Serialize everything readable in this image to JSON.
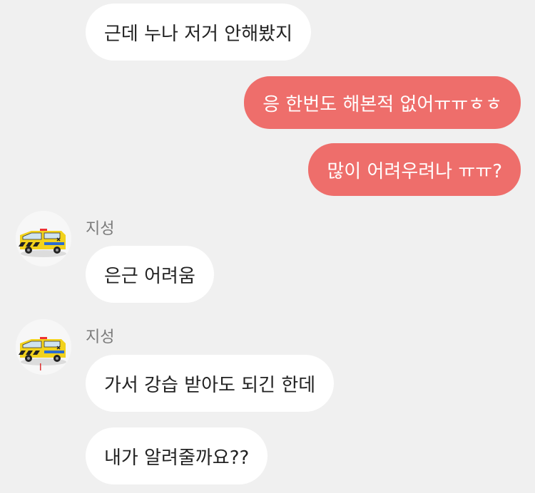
{
  "colors": {
    "background": "#f0f0f0",
    "incoming_bubble": "#ffffff",
    "outgoing_bubble": "#ee6e6b",
    "sender_name": "#7a7a7a"
  },
  "messages": [
    {
      "side": "in",
      "text": "근데 누나 저거 안해봤지"
    },
    {
      "side": "out",
      "text": "응 한번도 해본적 없어ㅠㅠㅎㅎ"
    },
    {
      "side": "out",
      "text": "많이 어려우려나 ㅠㅠ?"
    },
    {
      "side": "in",
      "sender": "지성",
      "avatar": "ambulance-toy-avatar",
      "text": "은근 어려움"
    },
    {
      "side": "in",
      "sender": "지성",
      "avatar": "ambulance-toy-avatar",
      "text": "가서 강습 받아도 되긴 한데"
    },
    {
      "side": "in",
      "text": "내가 알려줄까요??"
    }
  ]
}
